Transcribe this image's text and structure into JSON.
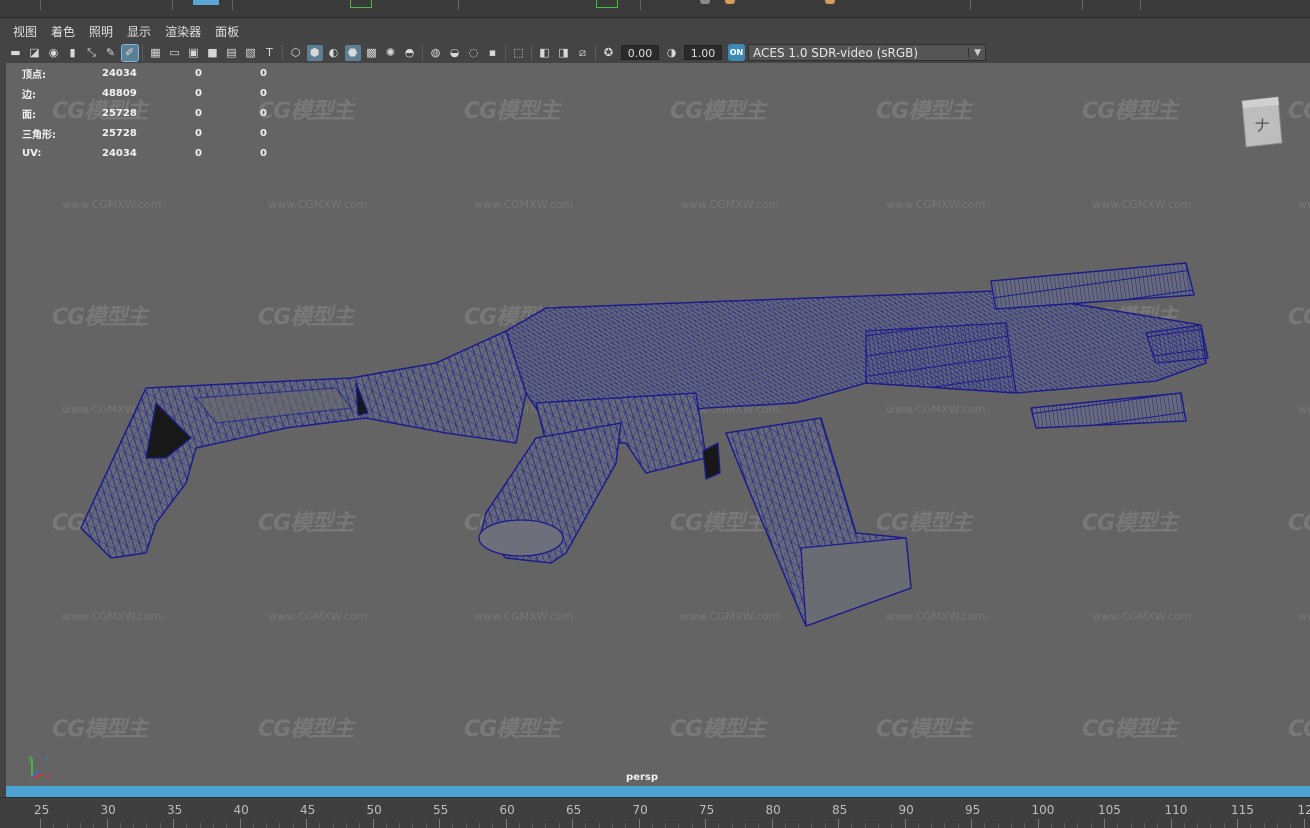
{
  "menu": [
    "视图",
    "着色",
    "照明",
    "显示",
    "渲染器",
    "面板"
  ],
  "toolbar": {
    "exposure_value": "0.00",
    "gamma_value": "1.00",
    "color_space": "ACES 1.0 SDR-video (sRGB)",
    "color_mgmt_toggle": "ON"
  },
  "hud": {
    "rows": [
      {
        "label": "顶点:",
        "v1": "24034",
        "v2": "0",
        "v3": "0"
      },
      {
        "label": "边:",
        "v1": "48809",
        "v2": "0",
        "v3": "0"
      },
      {
        "label": "面:",
        "v1": "25728",
        "v2": "0",
        "v3": "0"
      },
      {
        "label": "三角形:",
        "v1": "25728",
        "v2": "0",
        "v3": "0"
      },
      {
        "label": "UV:",
        "v1": "24034",
        "v2": "0",
        "v3": "0"
      }
    ]
  },
  "viewport": {
    "camera_label": "persp",
    "viewcube_face": "ナ",
    "axis_labels": {
      "y": "y",
      "z": "z",
      "x": "x"
    },
    "watermark_logo": "CG模型主",
    "watermark_url": "www.CGMXW.com"
  },
  "timeline": {
    "ticks": [
      "25",
      "30",
      "35",
      "40",
      "45",
      "50",
      "55",
      "60",
      "65",
      "70",
      "75",
      "80",
      "85",
      "90",
      "95",
      "100",
      "105",
      "110",
      "115",
      "12"
    ]
  },
  "colors": {
    "viewport_bg": "#646464",
    "wireframe": "#1c1c8c",
    "timeline_accent": "#4aa3d1",
    "ui_bg": "#444444"
  }
}
